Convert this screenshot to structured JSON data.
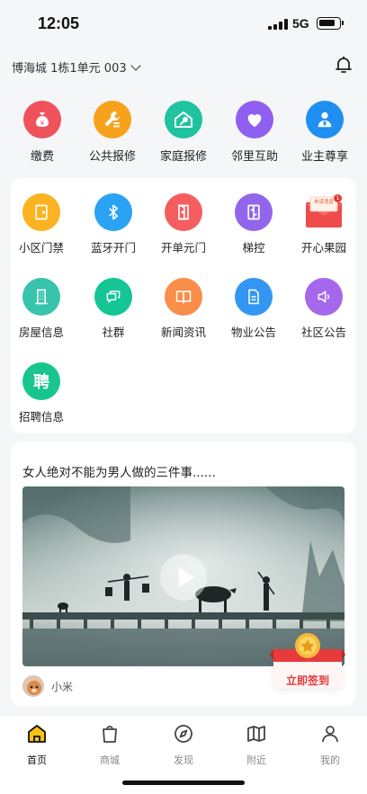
{
  "status_bar": {
    "time": "12:05",
    "network": "5G"
  },
  "header": {
    "address": "博海城 1栋1单元 003",
    "icons": {
      "dropdown": "chevron-down-icon",
      "notification": "bell-icon"
    }
  },
  "quick_actions": [
    {
      "label": "缴费",
      "icon": "coin-bag-icon",
      "color": "#f0525c"
    },
    {
      "label": "公共报修",
      "icon": "tools-icon",
      "color": "#f7a21b"
    },
    {
      "label": "家庭报修",
      "icon": "house-wrench-icon",
      "color": "#1fc3a0"
    },
    {
      "label": "邻里互助",
      "icon": "heart-icon",
      "color": "#8f5ff1"
    },
    {
      "label": "业主尊享",
      "icon": "owner-badge-icon",
      "color": "#1f8ff2"
    }
  ],
  "services": [
    {
      "label": "小区门禁",
      "icon": "door-icon",
      "color": "#fbb321"
    },
    {
      "label": "蓝牙开门",
      "icon": "bluetooth-icon",
      "color": "#2aa3f4"
    },
    {
      "label": "开单元门",
      "icon": "unit-door-icon",
      "color": "#f55e61"
    },
    {
      "label": "梯控",
      "icon": "elevator-icon",
      "color": "#9166ec"
    },
    {
      "label": "开心果园",
      "icon": "envelope-icon",
      "color": "#ef4b4b",
      "badge": "未读消息",
      "badge_count": "1"
    },
    {
      "label": "房屋信息",
      "icon": "building-icon",
      "color": "#37c3ac"
    },
    {
      "label": "社群",
      "icon": "chat-icon",
      "color": "#14c595"
    },
    {
      "label": "新闻资讯",
      "icon": "book-icon",
      "color": "#f88e4a"
    },
    {
      "label": "物业公告",
      "icon": "document-icon",
      "color": "#3396f2"
    },
    {
      "label": "社区公告",
      "icon": "speaker-icon",
      "color": "#a568ec"
    },
    {
      "label": "招聘信息",
      "icon": "recruit-icon",
      "color": "#18c58c",
      "glyph": "聘"
    }
  ],
  "feed": {
    "title": "女人绝对不能为男人做的三件事......",
    "author": "小米",
    "icons": {
      "play": "play-icon"
    }
  },
  "sign_in": {
    "label": "立即签到",
    "icon": "medal-icon"
  },
  "tabbar": [
    {
      "label": "首页",
      "icon": "home-icon",
      "active": true
    },
    {
      "label": "商城",
      "icon": "shopping-bag-icon",
      "active": false
    },
    {
      "label": "发现",
      "icon": "compass-icon",
      "active": false
    },
    {
      "label": "附近",
      "icon": "map-icon",
      "active": false
    },
    {
      "label": "我的",
      "icon": "user-icon",
      "active": false
    }
  ],
  "colors": {
    "background": "#f5f6f8",
    "card": "#ffffff",
    "accent_red": "#e23b3b",
    "home_active": "#f7c317"
  }
}
